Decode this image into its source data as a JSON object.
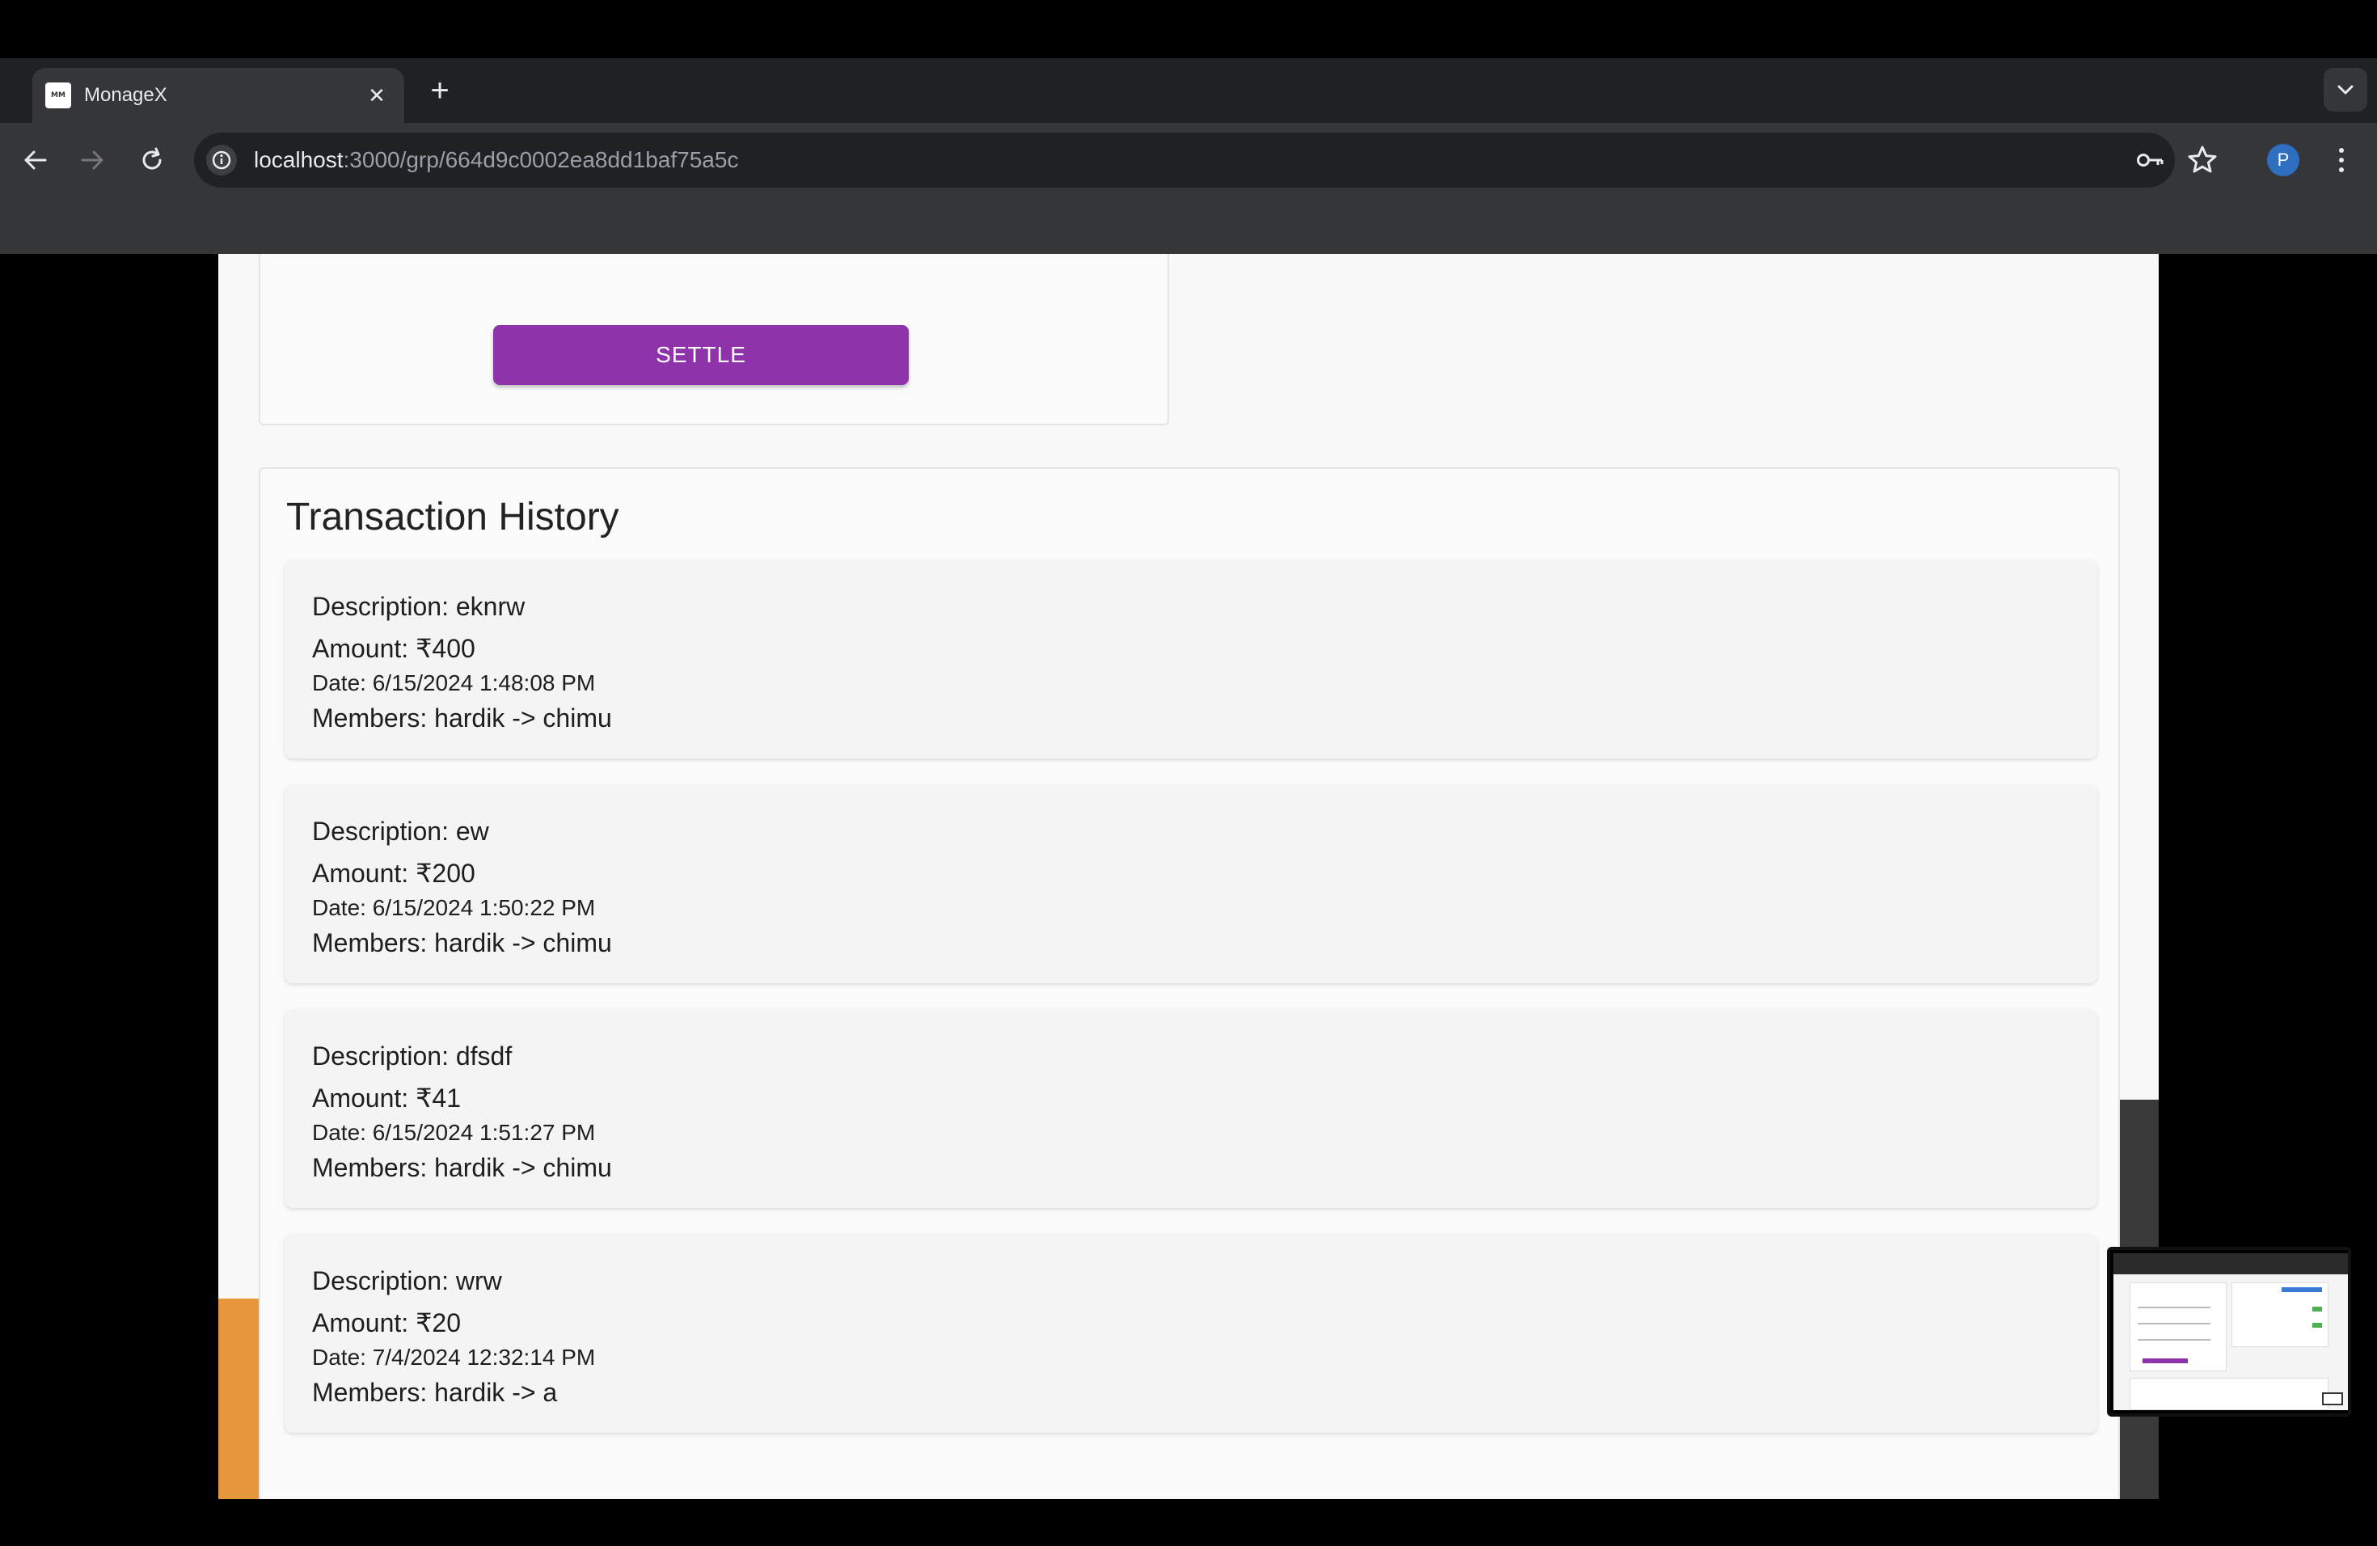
{
  "browser": {
    "tab_title": "MonageX",
    "favicon_text": "MM",
    "new_tab_symbol": "+",
    "close_symbol": "✕",
    "url_host": "localhost",
    "url_rest": ":3000/grp/664d9c0002ea8dd1baf75a5c",
    "profile_initial": "P"
  },
  "settle": {
    "button_label": "SETTLE"
  },
  "history": {
    "title": "Transaction History",
    "transactions": [
      {
        "description": "Description: eknrw",
        "amount": "Amount: ₹400",
        "date": "Date: 6/15/2024 1:48:08 PM",
        "members": "Members: hardik -> chimu"
      },
      {
        "description": "Description: ew",
        "amount": "Amount: ₹200",
        "date": "Date: 6/15/2024 1:50:22 PM",
        "members": "Members: hardik -> chimu"
      },
      {
        "description": "Description: dfsdf",
        "amount": "Amount: ₹41",
        "date": "Date: 6/15/2024 1:51:27 PM",
        "members": "Members: hardik -> chimu"
      },
      {
        "description": "Description: wrw",
        "amount": "Amount: ₹20",
        "date": "Date: 7/4/2024 12:32:14 PM",
        "members": "Members: hardik -> a"
      }
    ]
  },
  "colors": {
    "settle_button": "#8e33a9",
    "accent_orange": "#e8963c",
    "avatar_blue": "#2d6ec0"
  }
}
